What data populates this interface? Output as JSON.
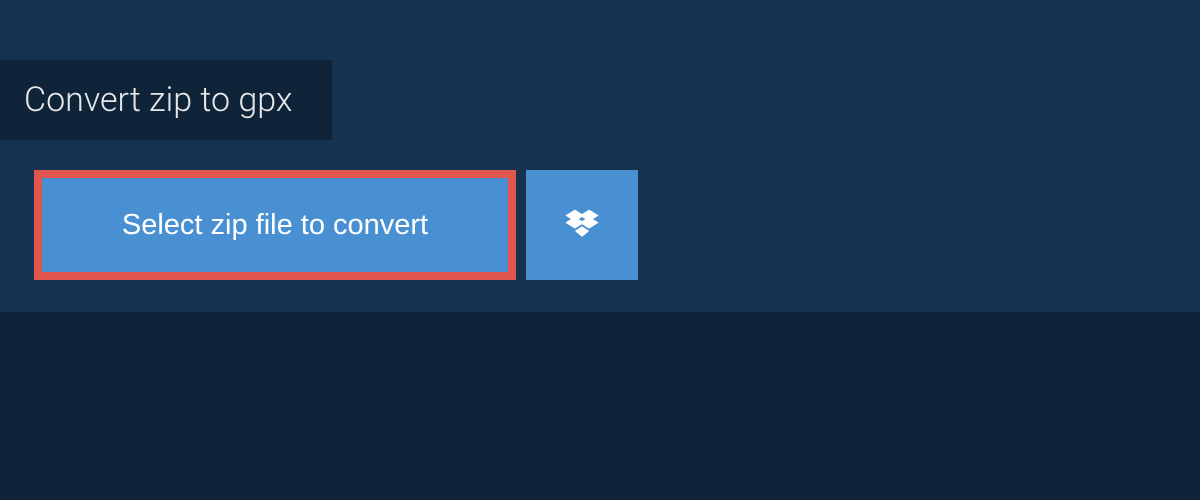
{
  "tab": {
    "title": "Convert zip to gpx"
  },
  "actions": {
    "select_file_label": "Select zip file to convert"
  },
  "colors": {
    "page_bg": "#0f2438",
    "panel_bg": "#15334f",
    "button_bg": "#4990d2",
    "highlight_border": "#e0564e",
    "text_light": "#e8e8e8",
    "text_white": "#ffffff"
  }
}
